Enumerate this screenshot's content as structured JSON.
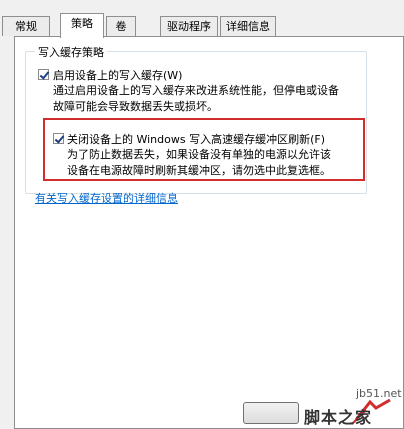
{
  "tabs": [
    {
      "label": "常规"
    },
    {
      "label": "策略"
    },
    {
      "label": "卷"
    },
    {
      "label": "驱动程序"
    },
    {
      "label": "详细信息"
    }
  ],
  "active_tab": "策略",
  "group": {
    "legend": "写入缓存策略",
    "option1": {
      "label": "启用设备上的写入缓存(W)",
      "checked": true,
      "desc_line1": "通过启用设备上的写入缓存来改进系统性能，但停电或设备",
      "desc_line2": "故障可能会导致数据丢失或损坏。"
    },
    "option2": {
      "label": "关闭设备上的 Windows 写入高速缓存缓冲区刷新(F)",
      "checked": true,
      "desc_line1": "为了防止数据丢失，如果设备没有单独的电源以允许该",
      "desc_line2": "设备在电源故障时刷新其缓冲区，请勿选中此复选框。"
    }
  },
  "link": "有关写入缓存设置的详细信息",
  "watermark": {
    "url": "jb51.net",
    "text": "脚本之家"
  },
  "colors": {
    "highlight_border": "#d22d2d",
    "link": "#0066cc"
  }
}
